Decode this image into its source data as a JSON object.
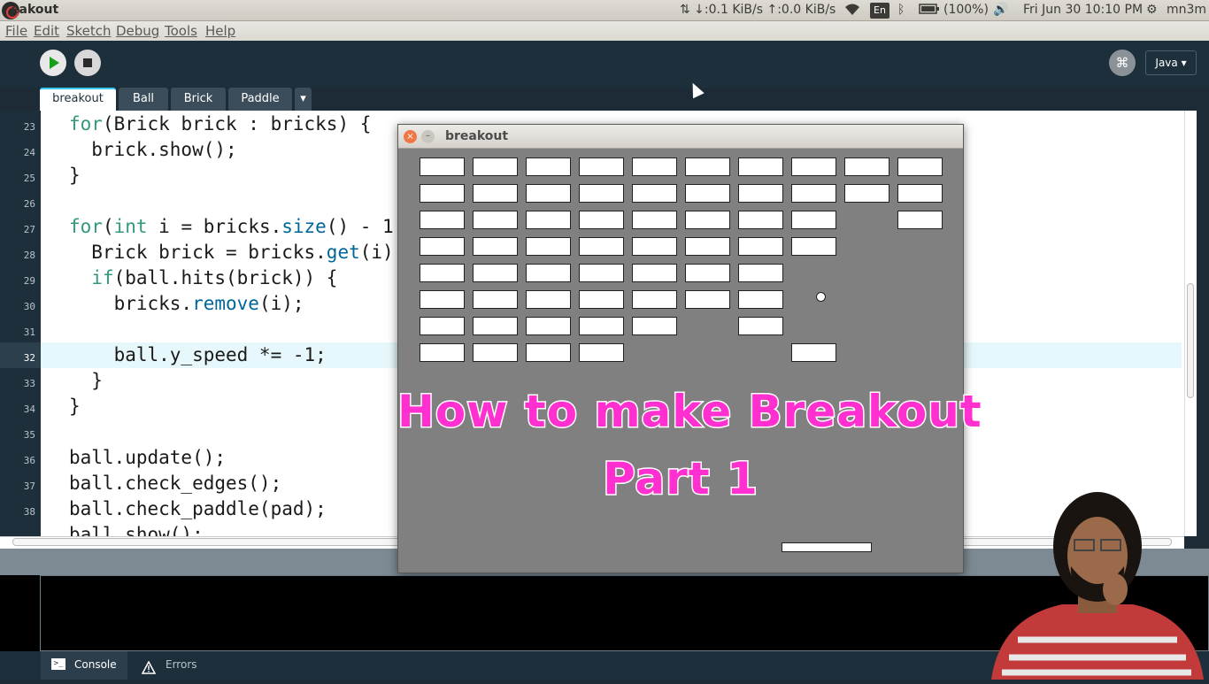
{
  "topbar": {
    "window_title": "eakout",
    "network": "⇅ ↓:0.1 KiB/s ↑:0.0 KiB/s",
    "language": "En",
    "battery": "(100%)",
    "datetime": "Fri Jun 30 10:10 PM",
    "user": "mn3m"
  },
  "menubar": {
    "items": [
      "File",
      "Edit",
      "Sketch",
      "Debug",
      "Tools",
      "Help"
    ]
  },
  "toolbar": {
    "debug_symbol": "⌘",
    "mode": "Java ▾"
  },
  "tabs": {
    "items": [
      "breakout",
      "Ball",
      "Brick",
      "Paddle"
    ],
    "menu": "▾"
  },
  "editor": {
    "current_line": 32,
    "line_numbers": [
      "23",
      "24",
      "25",
      "26",
      "27",
      "28",
      "29",
      "30",
      "31",
      "32",
      "33",
      "34",
      "35",
      "36",
      "37",
      "38"
    ],
    "lines": [
      "for(Brick brick : bricks) {",
      "  brick.show();",
      "}",
      "",
      "for(int i = bricks.size() - 1",
      "  Brick brick = bricks.get(i)",
      "  if(ball.hits(brick)) {",
      "    bricks.remove(i);",
      "",
      "    ball.y_speed *= -1;",
      "  }",
      "}",
      "",
      "ball.update();",
      "ball.check_edges();",
      "ball.check_paddle(pad);",
      "ball.show();"
    ]
  },
  "sketch_window": {
    "title": "breakout",
    "close_symbol": "×",
    "min_symbol": "–",
    "overlay_line1": "How to make Breakout",
    "overlay_line2": "Part 1",
    "brick_rows": [
      [
        1,
        1,
        1,
        1,
        1,
        1,
        1,
        1,
        1,
        1
      ],
      [
        1,
        1,
        1,
        1,
        1,
        1,
        1,
        1,
        1,
        1
      ],
      [
        1,
        1,
        1,
        1,
        1,
        1,
        1,
        1,
        0,
        1
      ],
      [
        1,
        1,
        1,
        1,
        1,
        1,
        1,
        1,
        0,
        0
      ],
      [
        1,
        1,
        1,
        1,
        1,
        1,
        1,
        0,
        0,
        0
      ],
      [
        1,
        1,
        1,
        1,
        1,
        1,
        1,
        0,
        0,
        0
      ],
      [
        1,
        1,
        1,
        1,
        1,
        0,
        1,
        0,
        0,
        0
      ],
      [
        1,
        1,
        1,
        1,
        0,
        0,
        0,
        1,
        0,
        0
      ]
    ]
  },
  "console": {
    "tabs": [
      "Console",
      "Errors"
    ]
  },
  "colors": {
    "overlay_text": "#ff2fd0",
    "keyword": "#33997e",
    "function": "#006699",
    "ide_dark": "#1e2f3c"
  }
}
